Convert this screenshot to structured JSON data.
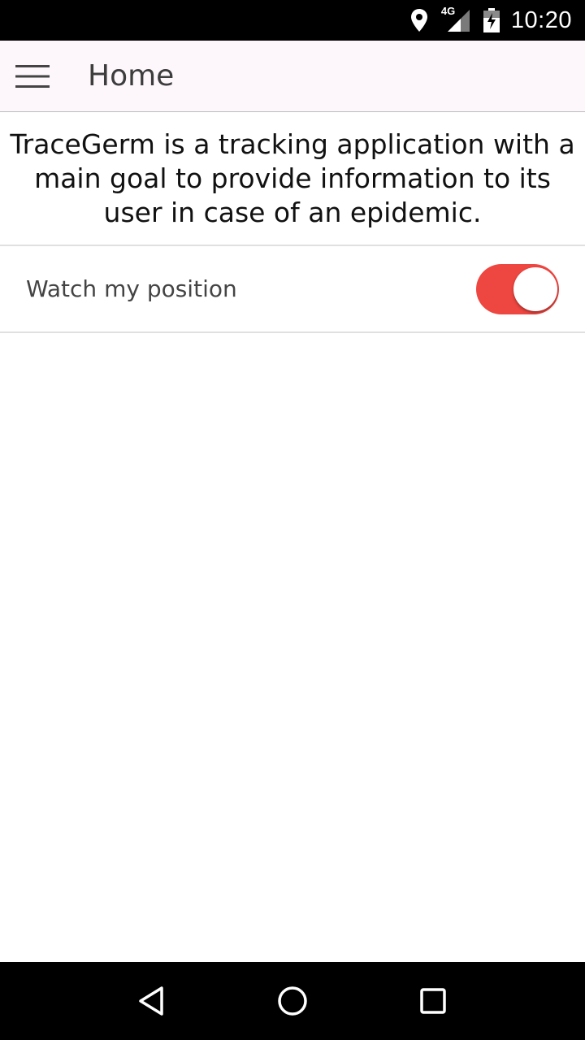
{
  "status_bar": {
    "network_label": "4G",
    "time": "10:20",
    "icons": [
      "location-icon",
      "signal-icon",
      "battery-charging-icon"
    ]
  },
  "app_bar": {
    "title": "Home",
    "menu_icon": "hamburger-menu-icon"
  },
  "intro": {
    "text": "TraceGerm is a tracking application with a main goal to provide information to its user in case of an epidemic."
  },
  "settings": {
    "watch_position": {
      "label": "Watch my position",
      "enabled": true
    }
  },
  "nav_bar": {
    "icons": [
      "back-icon",
      "home-icon",
      "recents-icon"
    ]
  },
  "colors": {
    "accent": "#ee4640",
    "app_bar_bg": "#fdf7fc",
    "system_bar": "#000000"
  }
}
